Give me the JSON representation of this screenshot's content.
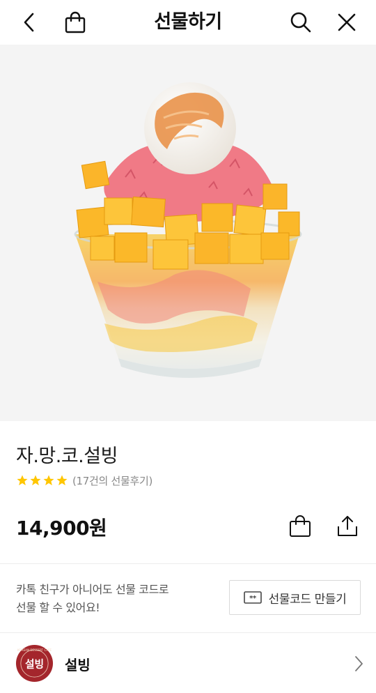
{
  "header": {
    "title": "선물하기",
    "icons": [
      "back-icon",
      "shopping-bag-icon",
      "search-icon",
      "close-icon"
    ]
  },
  "product": {
    "image_icon": "bingsu-dessert-image",
    "name": "자.망.코.설빙",
    "rating_stars": 4,
    "rating_max": 5,
    "review_text": "(17건의 선물후기)",
    "price": "14,900원"
  },
  "gift_code": {
    "description_line1": "카톡 친구가 아니어도 선물 코드로",
    "description_line2": "선물 할 수 있어요!",
    "button_label": "선물코드 만들기",
    "button_icon": "code-box-icon"
  },
  "brand": {
    "name": "설빙",
    "logo_text": "설빙",
    "logo_ring_text": "KOREAN DESSERT CAFE"
  },
  "colors": {
    "star": "#FFC600",
    "logo_red": "#A4262C"
  }
}
